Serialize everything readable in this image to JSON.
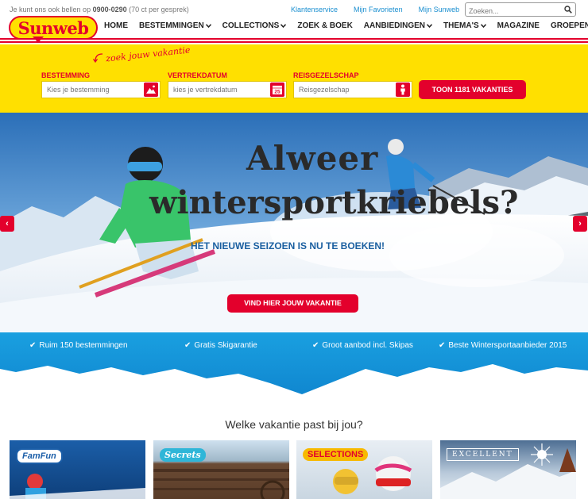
{
  "topbar": {
    "phone_prefix": "Je kunt ons ook bellen op",
    "phone_number": "0900-0290",
    "phone_suffix": "(70 ct per gesprek)",
    "links": [
      "Klantenservice",
      "Mijn Favorieten",
      "Mijn Sunweb"
    ],
    "search_placeholder": "Zoeken..."
  },
  "brand": {
    "logo_text": "Sunweb",
    "tagline": "zoek jouw vakantie",
    "colors": {
      "red": "#e3002c",
      "yellow": "#ffe000",
      "blue": "#1a8fd0"
    }
  },
  "nav": {
    "items": [
      {
        "label": "HOME",
        "dropdown": false
      },
      {
        "label": "BESTEMMINGEN",
        "dropdown": true
      },
      {
        "label": "COLLECTIONS",
        "dropdown": true
      },
      {
        "label": "ZOEK & BOEK",
        "dropdown": false
      },
      {
        "label": "AANBIEDINGEN",
        "dropdown": true
      },
      {
        "label": "THEMA'S",
        "dropdown": true
      },
      {
        "label": "MAGAZINE",
        "dropdown": false
      },
      {
        "label": "GROEPEN",
        "dropdown": false
      }
    ]
  },
  "search_form": {
    "destination_label": "BESTEMMING",
    "destination_placeholder": "Kies je bestemming",
    "date_label": "VERTREKDATUM",
    "date_placeholder": "kies je vertrekdatum",
    "date_icon_text": "25",
    "party_label": "REISGEZELSCHAP",
    "party_placeholder": "Reisgezelschap",
    "submit_label": "TOON 1181 VAKANTIES"
  },
  "hero": {
    "headline_line1": "Alweer",
    "headline_line2": "wintersportkriebels?",
    "subheadline": "HET NIEUWE SEIZOEN IS NU TE BOEKEN!",
    "cta_label": "VIND HIER JOUW VAKANTIE",
    "prev_arrow": "‹",
    "next_arrow": "›"
  },
  "usps": [
    "Ruim 150 bestemmingen",
    "Gratis Skigarantie",
    "Groot aanbod incl. Skipas",
    "Beste Wintersportaanbieder 2015"
  ],
  "section": {
    "title": "Welke vakantie past bij jou?",
    "cards": [
      {
        "badge": "FamFun"
      },
      {
        "badge": "Secrets"
      },
      {
        "badge": "SELECTIONS"
      },
      {
        "badge": "EXCELLENT"
      }
    ]
  }
}
